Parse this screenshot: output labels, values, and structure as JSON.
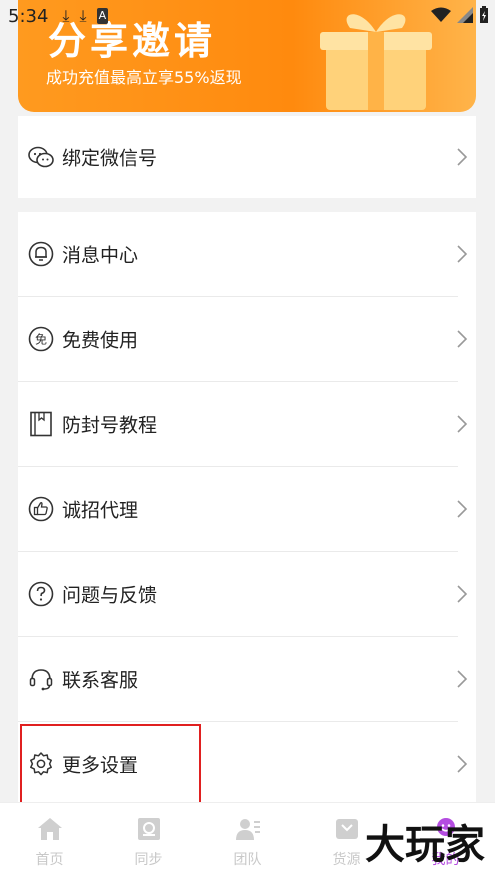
{
  "status_bar": {
    "time": "5:34"
  },
  "banner": {
    "title": "分享邀请",
    "subtitle": "成功充值最高立享55%返现"
  },
  "menu_top": [
    {
      "label": "绑定微信号",
      "icon": "wechat-icon"
    }
  ],
  "menu_main": [
    {
      "label": "消息中心",
      "icon": "bell-icon"
    },
    {
      "label": "免费使用",
      "icon": "free-icon"
    },
    {
      "label": "防封号教程",
      "icon": "book-icon"
    },
    {
      "label": "诚招代理",
      "icon": "thumbs-up-icon"
    },
    {
      "label": "问题与反馈",
      "icon": "question-icon"
    },
    {
      "label": "联系客服",
      "icon": "headset-icon"
    },
    {
      "label": "更多设置",
      "icon": "gear-icon"
    }
  ],
  "free_icon_text": "免",
  "tabbar": [
    {
      "label": "首页",
      "icon": "home-icon"
    },
    {
      "label": "同步",
      "icon": "sync-icon"
    },
    {
      "label": "团队",
      "icon": "team-icon"
    },
    {
      "label": "货源",
      "icon": "goods-icon"
    },
    {
      "label": "我的",
      "icon": "me-icon"
    }
  ],
  "watermark": "大玩家",
  "colors": {
    "banner_orange": "#ff8a0e",
    "tab_inactive": "#c8c8c8",
    "tab_active": "#b44ce0",
    "highlight": "#e02020"
  }
}
